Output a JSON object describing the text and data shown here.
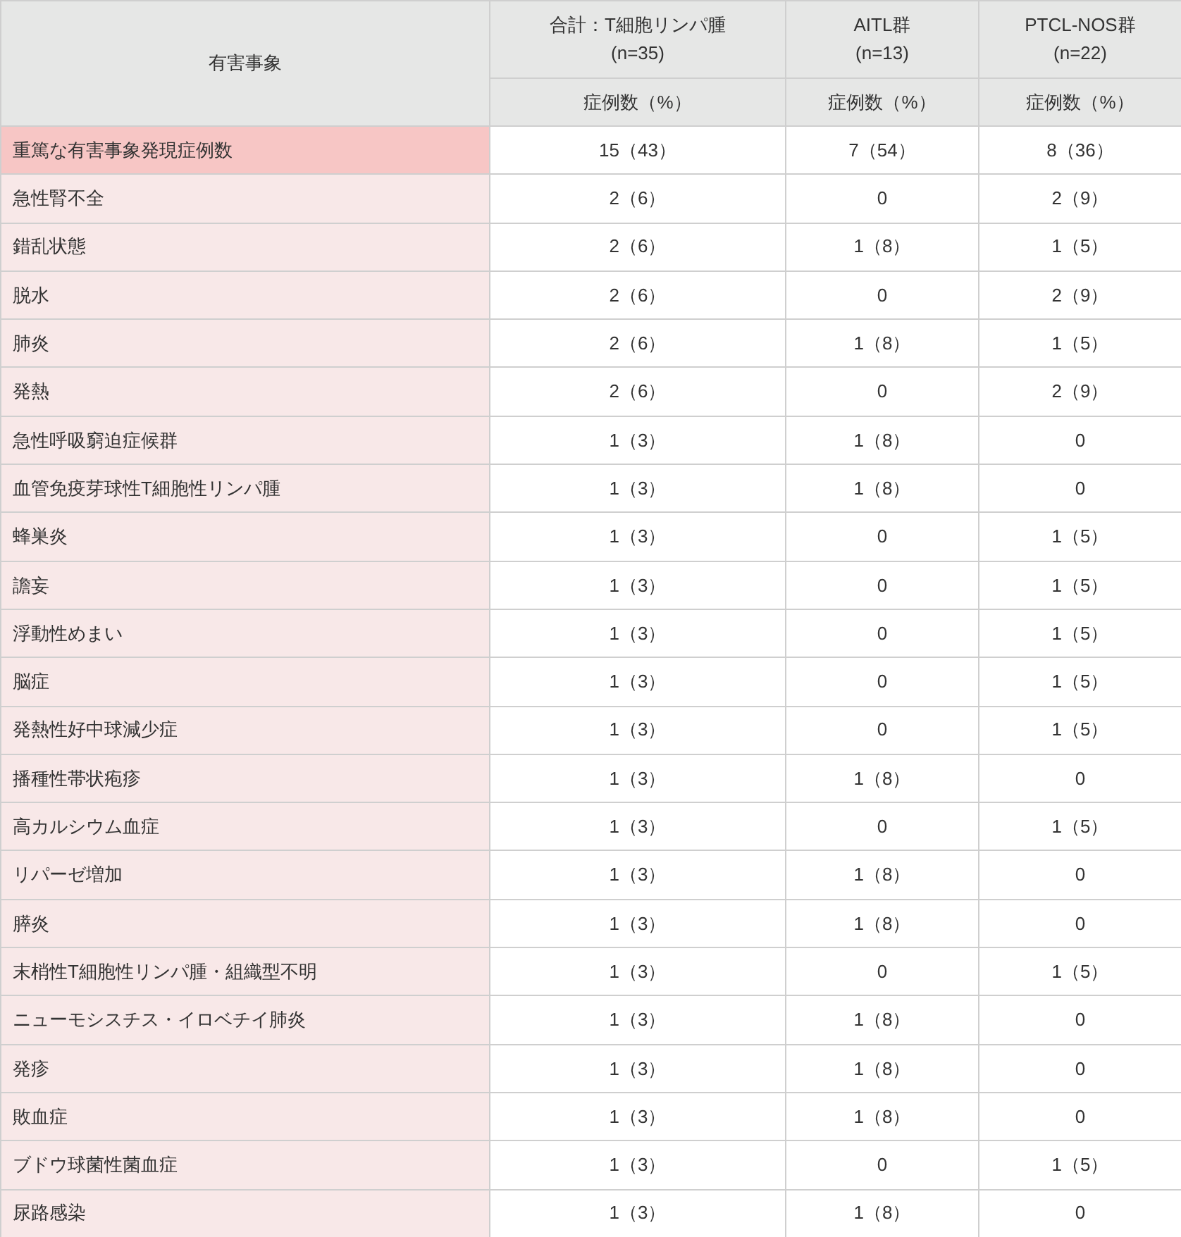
{
  "table": {
    "corner_header": "有害事象",
    "group_headers": [
      {
        "label": "合計：T細胞リンパ腫",
        "n": "(n=35)"
      },
      {
        "label": "AITL群",
        "n": "(n=13)"
      },
      {
        "label": "PTCL-NOS群",
        "n": "(n=22)"
      }
    ],
    "sub_headers": [
      "症例数（%）",
      "症例数（%）",
      "症例数（%）"
    ],
    "rows": [
      {
        "kind": "summary",
        "event": "重篤な有害事象発現症例数",
        "values": [
          "15（43）",
          "7（54）",
          "8（36）"
        ]
      },
      {
        "kind": "event",
        "event": "急性腎不全",
        "values": [
          "2（6）",
          "0",
          "2（9）"
        ]
      },
      {
        "kind": "event",
        "event": "錯乱状態",
        "values": [
          "2（6）",
          "1（8）",
          "1（5）"
        ]
      },
      {
        "kind": "event",
        "event": "脱水",
        "values": [
          "2（6）",
          "0",
          "2（9）"
        ]
      },
      {
        "kind": "event",
        "event": "肺炎",
        "values": [
          "2（6）",
          "1（8）",
          "1（5）"
        ]
      },
      {
        "kind": "event",
        "event": "発熱",
        "values": [
          "2（6）",
          "0",
          "2（9）"
        ]
      },
      {
        "kind": "event",
        "event": "急性呼吸窮迫症候群",
        "values": [
          "1（3）",
          "1（8）",
          "0"
        ]
      },
      {
        "kind": "event",
        "event": "血管免疫芽球性T細胞性リンパ腫",
        "values": [
          "1（3）",
          "1（8）",
          "0"
        ]
      },
      {
        "kind": "event",
        "event": "蜂巣炎",
        "values": [
          "1（3）",
          "0",
          "1（5）"
        ]
      },
      {
        "kind": "event",
        "event": "譫妄",
        "values": [
          "1（3）",
          "0",
          "1（5）"
        ]
      },
      {
        "kind": "event",
        "event": "浮動性めまい",
        "values": [
          "1（3）",
          "0",
          "1（5）"
        ]
      },
      {
        "kind": "event",
        "event": "脳症",
        "values": [
          "1（3）",
          "0",
          "1（5）"
        ]
      },
      {
        "kind": "event",
        "event": "発熱性好中球減少症",
        "values": [
          "1（3）",
          "0",
          "1（5）"
        ]
      },
      {
        "kind": "event",
        "event": "播種性帯状疱疹",
        "values": [
          "1（3）",
          "1（8）",
          "0"
        ]
      },
      {
        "kind": "event",
        "event": "高カルシウム血症",
        "values": [
          "1（3）",
          "0",
          "1（5）"
        ]
      },
      {
        "kind": "event",
        "event": "リパーゼ増加",
        "values": [
          "1（3）",
          "1（8）",
          "0"
        ]
      },
      {
        "kind": "event",
        "event": "膵炎",
        "values": [
          "1（3）",
          "1（8）",
          "0"
        ]
      },
      {
        "kind": "event",
        "event": "末梢性T細胞性リンパ腫・組織型不明",
        "values": [
          "1（3）",
          "0",
          "1（5）"
        ]
      },
      {
        "kind": "event",
        "event": "ニューモシスチス・イロベチイ肺炎",
        "values": [
          "1（3）",
          "1（8）",
          "0"
        ]
      },
      {
        "kind": "event",
        "event": "発疹",
        "values": [
          "1（3）",
          "1（8）",
          "0"
        ]
      },
      {
        "kind": "event",
        "event": "敗血症",
        "values": [
          "1（3）",
          "1（8）",
          "0"
        ]
      },
      {
        "kind": "event",
        "event": "ブドウ球菌性菌血症",
        "values": [
          "1（3）",
          "0",
          "1（5）"
        ]
      },
      {
        "kind": "event",
        "event": "尿路感染",
        "values": [
          "1（3）",
          "1（8）",
          "0"
        ]
      }
    ]
  }
}
